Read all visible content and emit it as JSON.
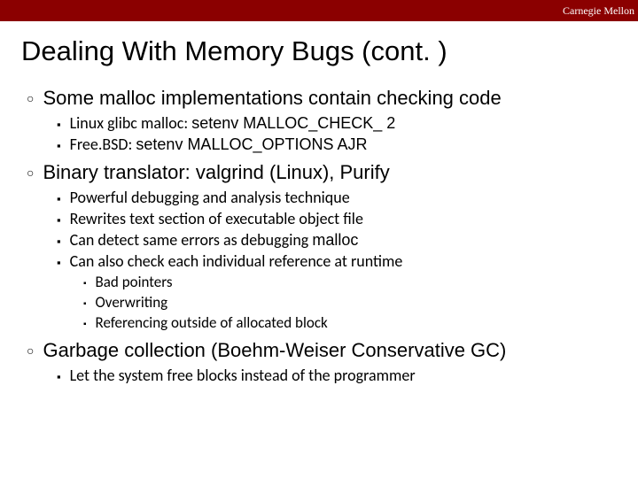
{
  "header": {
    "org": "Carnegie Mellon"
  },
  "title": "Dealing With Memory Bugs (cont. )",
  "items": [
    {
      "text": "Some malloc implementations contain checking code",
      "sub": [
        {
          "prefix": "Linux glibc malloc: ",
          "code": "setenv MALLOC_CHECK_ 2"
        },
        {
          "prefix": "Free.BSD: ",
          "code": "setenv MALLOC_OPTIONS AJR"
        }
      ]
    },
    {
      "text": "Binary translator: valgrind (Linux), Purify",
      "sub": [
        {
          "prefix": "Powerful debugging and analysis technique"
        },
        {
          "prefix": "Rewrites text section of executable object file"
        },
        {
          "prefix": "Can detect same errors as debugging ",
          "code": "malloc"
        },
        {
          "prefix": "Can also check each individual reference at runtime",
          "sub": [
            {
              "text": "Bad pointers"
            },
            {
              "text": "Overwriting"
            },
            {
              "text": "Referencing outside of allocated block"
            }
          ]
        }
      ]
    },
    {
      "text": "Garbage collection (Boehm-Weiser Conservative GC)",
      "sub": [
        {
          "prefix": "Let the system free blocks instead of the programmer"
        }
      ]
    }
  ]
}
